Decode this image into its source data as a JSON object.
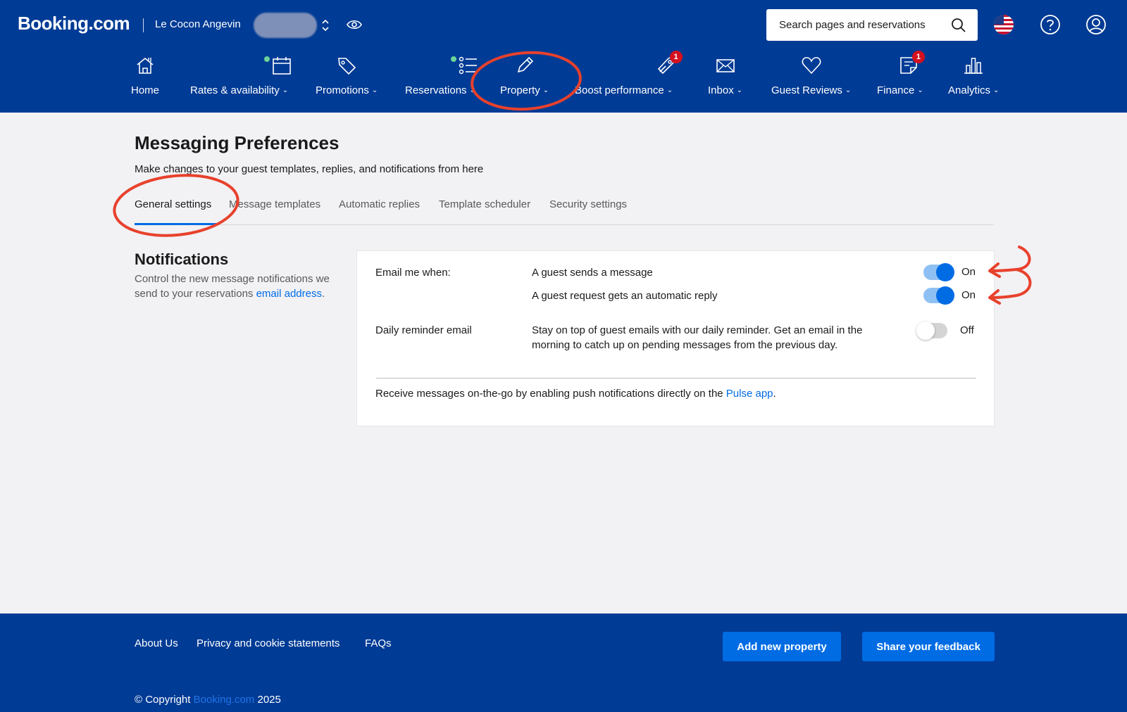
{
  "header": {
    "logo": "Booking.com",
    "property_name": "Le Cocon Angevin",
    "search_placeholder": "Search pages and reservations"
  },
  "nav": [
    {
      "label": "Home",
      "icon": "home-icon",
      "chevron": false
    },
    {
      "label": "Rates & availability",
      "icon": "calendar-icon",
      "chevron": true,
      "dot": true
    },
    {
      "label": "Promotions",
      "icon": "tag-icon",
      "chevron": true
    },
    {
      "label": "Reservations",
      "icon": "list-icon",
      "chevron": true,
      "dot": true
    },
    {
      "label": "Property",
      "icon": "pencil-icon",
      "chevron": true
    },
    {
      "label": "Boost performance",
      "icon": "rocket-icon",
      "chevron": true,
      "badge": "1"
    },
    {
      "label": "Inbox",
      "icon": "envelope-icon",
      "chevron": true
    },
    {
      "label": "Guest Reviews",
      "icon": "heart-icon",
      "chevron": true
    },
    {
      "label": "Finance",
      "icon": "invoice-icon",
      "chevron": true,
      "badge": "1"
    },
    {
      "label": "Analytics",
      "icon": "bar-chart-icon",
      "chevron": true
    }
  ],
  "main": {
    "title": "Messaging Preferences",
    "subtitle": "Make changes to your guest templates, replies, and notifications from here",
    "tabs": [
      "General settings",
      "Message templates",
      "Automatic replies",
      "Template scheduler",
      "Security settings"
    ],
    "active_tab": "General settings"
  },
  "notifications": {
    "heading": "Notifications",
    "description": "Control the new message notifications we send to your reservations",
    "link": "email address",
    "description_end": "."
  },
  "card": {
    "email_label": "Email me when:",
    "option1": "A guest sends a message",
    "option1_state": "On",
    "option2": "A guest request gets an automatic reply",
    "option2_state": "On",
    "daily_label": "Daily reminder email",
    "daily_text": "Stay on top of guest emails with our daily reminder. Get an email in the morning to catch up on pending messages from the previous day.",
    "daily_state": "Off",
    "push_text": "Receive messages on-the-go by enabling push notifications directly on the",
    "push_link": "Pulse app",
    "push_end": "."
  },
  "footer": {
    "links": [
      "About Us",
      "Privacy and cookie statements",
      "FAQs"
    ],
    "add_property": "Add new property",
    "feedback": "Share your feedback",
    "copyright_prefix": "© Copyright",
    "copyright_brand": "Booking.com",
    "copyright_year": "2025"
  },
  "colors": {
    "brand_blue": "#003b95",
    "accent_blue": "#006ce4",
    "annotation_red": "#e8412c"
  }
}
